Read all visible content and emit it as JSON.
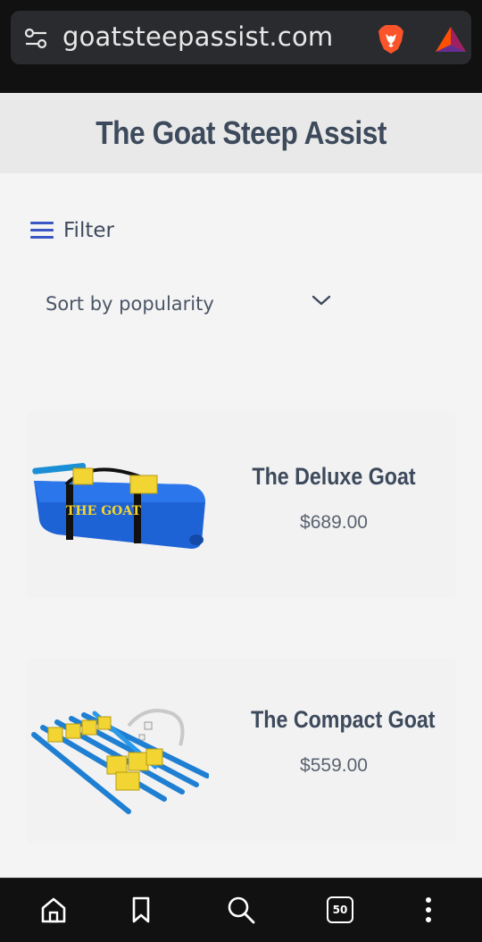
{
  "browser": {
    "url": "goatsteepassist.com",
    "tabs_count": "50",
    "icons": [
      "tune-icon",
      "brave-lion-icon",
      "bat-triangle-icon",
      "home-icon",
      "bookmark-icon",
      "search-icon",
      "tabs-icon",
      "more-vertical-icon"
    ]
  },
  "site": {
    "title": "The Goat Steep Assist"
  },
  "filter": {
    "label": "Filter"
  },
  "sort": {
    "selected": "Sort by popularity"
  },
  "products": [
    {
      "name": "The Deluxe Goat",
      "price": "$689.00",
      "bag_text": "THE GOAT"
    },
    {
      "name": "The Compact Goat",
      "price": "$559.00"
    }
  ],
  "colors": {
    "accent": "#3b55c4",
    "title": "#3d4a5c",
    "chrome": "#111111"
  }
}
